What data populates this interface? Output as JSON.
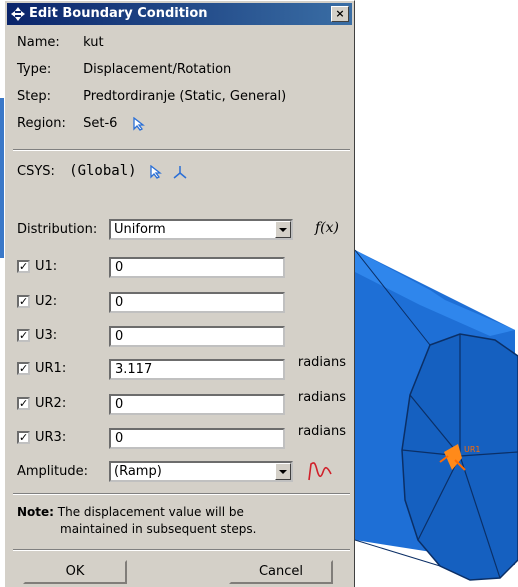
{
  "dialog": {
    "title": "Edit Boundary Condition",
    "close": "×",
    "name_label": "Name:",
    "name_value": "kut",
    "type_label": "Type:",
    "type_value": "Displacement/Rotation",
    "step_label": "Step:",
    "step_value": "Predtordiranje (Static, General)",
    "region_label": "Region:",
    "region_value": "Set-6",
    "csys_label": "CSYS:",
    "csys_value": "(Global)",
    "distribution_label": "Distribution:",
    "distribution_value": "Uniform",
    "fx_label": "f(x)",
    "dofs": [
      {
        "label": "U1:",
        "value": "0",
        "unit": ""
      },
      {
        "label": "U2:",
        "value": "0",
        "unit": ""
      },
      {
        "label": "U3:",
        "value": "0",
        "unit": ""
      },
      {
        "label": "UR1:",
        "value": "3.117",
        "unit": "radians"
      },
      {
        "label": "UR2:",
        "value": "0",
        "unit": "radians"
      },
      {
        "label": "UR3:",
        "value": "0",
        "unit": "radians"
      }
    ],
    "checkmark": "✓",
    "amplitude_label": "Amplitude:",
    "amplitude_value": "(Ramp)",
    "note_label": "Note:",
    "note_line1": "The displacement value will be",
    "note_line2": "maintained in subsequent steps.",
    "ok_label": "OK",
    "cancel_label": "Cancel"
  },
  "viewport": {
    "model_color": "#1e72d8",
    "label_text": "UR1"
  }
}
